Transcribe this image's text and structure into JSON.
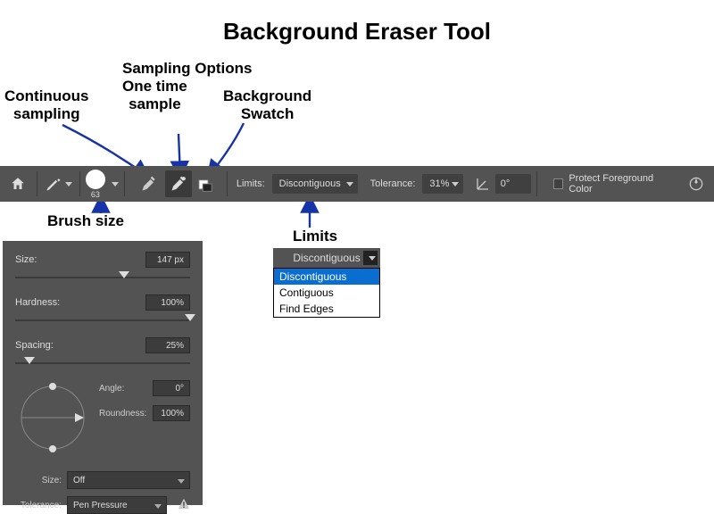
{
  "title": "Background Eraser Tool",
  "annotations": {
    "sampling_options": "Sampling Options",
    "continuous_sampling": "Continuous\nsampling",
    "one_time_sample": "One time\nsample",
    "background_swatch": "Background\nSwatch",
    "brush_size": "Brush size",
    "limits": "Limits"
  },
  "toolbar": {
    "brush_number": "63",
    "limits_label": "Limits:",
    "limits_value": "Discontiguous",
    "tolerance_label": "Tolerance:",
    "tolerance_value": "31%",
    "angle_value": "0°",
    "protect_fg_label": "Protect Foreground Color"
  },
  "brush_panel": {
    "size_label": "Size:",
    "size_value": "147 px",
    "hardness_label": "Hardness:",
    "hardness_value": "100%",
    "spacing_label": "Spacing:",
    "spacing_value": "25%",
    "angle_label": "Angle:",
    "angle_value": "0°",
    "roundness_label": "Roundness:",
    "roundness_value": "100%",
    "size_mode_label": "Size:",
    "size_mode_value": "Off",
    "tolerance_label": "Tolerance:",
    "tolerance_value": "Pen Pressure"
  },
  "limits_dropdown": {
    "selected": "Discontiguous",
    "options": [
      "Discontiguous",
      "Contiguous",
      "Find Edges"
    ]
  }
}
